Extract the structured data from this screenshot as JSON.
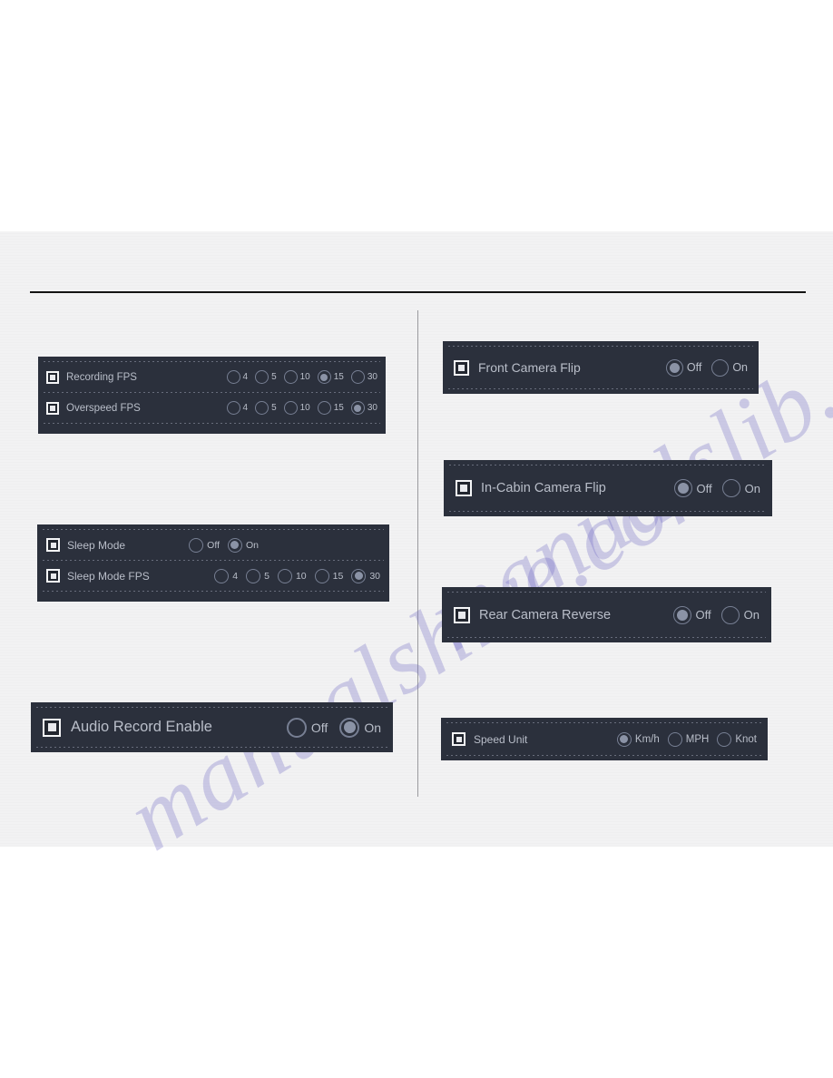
{
  "colors": {
    "page_background": "#ffffff",
    "sheet_background": "#f2f2f3",
    "panel_background": "#2b303c",
    "label_text": "#b9bec9",
    "radio_ring": "#777f93",
    "radio_fill": "#8b93a6",
    "checkbox_border": "#f4f5f7",
    "rule": "#131313",
    "divider": "#9a9a9e",
    "watermark": "#6c68c4"
  },
  "watermark": {
    "line1": "manualshive.com",
    "line2": "manualslib.com"
  },
  "panels": {
    "recording_fps": {
      "rows": [
        {
          "label": "Recording FPS",
          "checkbox_icon": "checkbox-checked-icon",
          "options": [
            {
              "label": "4",
              "selected": false
            },
            {
              "label": "5",
              "selected": false
            },
            {
              "label": "10",
              "selected": false
            },
            {
              "label": "15",
              "selected": true
            },
            {
              "label": "30",
              "selected": false
            }
          ]
        },
        {
          "label": "Overspeed FPS",
          "checkbox_icon": "checkbox-checked-icon",
          "options": [
            {
              "label": "4",
              "selected": false
            },
            {
              "label": "5",
              "selected": false
            },
            {
              "label": "10",
              "selected": false
            },
            {
              "label": "15",
              "selected": false
            },
            {
              "label": "30",
              "selected": true
            }
          ]
        }
      ]
    },
    "sleep_mode": {
      "rows": [
        {
          "label": "Sleep Mode",
          "checkbox_icon": "checkbox-checked-icon",
          "options": [
            {
              "label": "Off",
              "selected": false
            },
            {
              "label": "On",
              "selected": true
            }
          ]
        },
        {
          "label": "Sleep Mode FPS",
          "checkbox_icon": "checkbox-checked-icon",
          "options": [
            {
              "label": "4",
              "selected": false
            },
            {
              "label": "5",
              "selected": false
            },
            {
              "label": "10",
              "selected": false
            },
            {
              "label": "15",
              "selected": false
            },
            {
              "label": "30",
              "selected": true
            }
          ]
        }
      ]
    },
    "audio_record": {
      "rows": [
        {
          "label": "Audio Record Enable",
          "checkbox_icon": "checkbox-checked-icon",
          "options": [
            {
              "label": "Off",
              "selected": false
            },
            {
              "label": "On",
              "selected": true
            }
          ]
        }
      ]
    },
    "front_camera_flip": {
      "rows": [
        {
          "label": "Front Camera Flip",
          "checkbox_icon": "checkbox-checked-icon",
          "options": [
            {
              "label": "Off",
              "selected": true
            },
            {
              "label": "On",
              "selected": false
            }
          ]
        }
      ]
    },
    "in_cabin_camera_flip": {
      "rows": [
        {
          "label": "In-Cabin Camera Flip",
          "checkbox_icon": "checkbox-checked-icon",
          "options": [
            {
              "label": "Off",
              "selected": true
            },
            {
              "label": "On",
              "selected": false
            }
          ]
        }
      ]
    },
    "rear_camera_reverse": {
      "rows": [
        {
          "label": "Rear Camera Reverse",
          "checkbox_icon": "checkbox-checked-icon",
          "options": [
            {
              "label": "Off",
              "selected": true
            },
            {
              "label": "On",
              "selected": false
            }
          ]
        }
      ]
    },
    "speed_unit": {
      "rows": [
        {
          "label": "Speed Unit",
          "checkbox_icon": "checkbox-checked-icon",
          "options": [
            {
              "label": "Km/h",
              "selected": true
            },
            {
              "label": "MPH",
              "selected": false
            },
            {
              "label": "Knot",
              "selected": false
            }
          ]
        }
      ]
    }
  }
}
